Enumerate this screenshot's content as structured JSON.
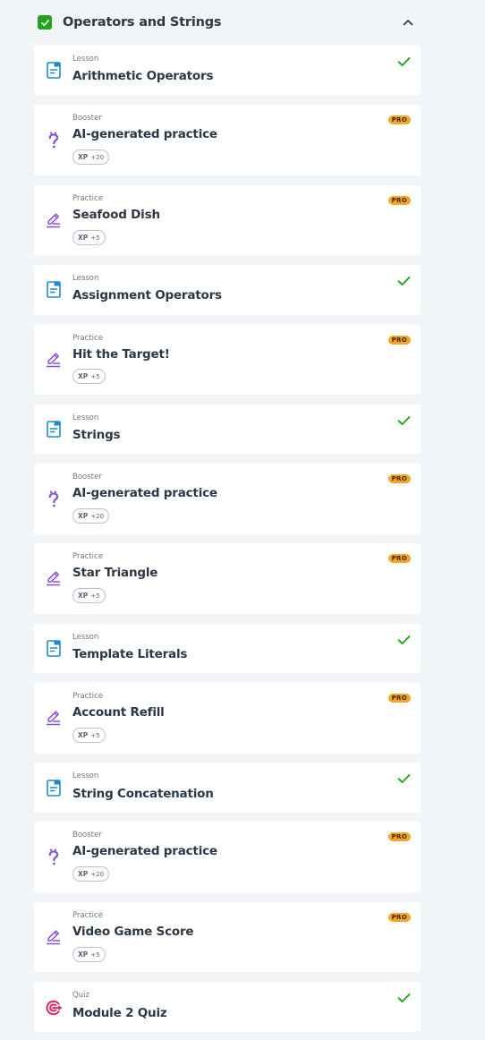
{
  "module": {
    "title": "Operators and Strings",
    "completed": true
  },
  "colors": {
    "lesson_icon": "#1a8ad4",
    "booster_icon": "#8a4fd8",
    "practice_icon": "#8a4fd8",
    "quiz_icon": "#e0245e",
    "check": "#1ea51a",
    "pro_badge": "#f5a623"
  },
  "items": [
    {
      "kind": "Lesson",
      "title": "Arithmetic Operators",
      "icon": "lesson-icon",
      "status": "completed"
    },
    {
      "kind": "Booster",
      "title": "AI-generated practice",
      "icon": "question-icon",
      "badge": "PRO",
      "xp_label": "XP",
      "xp_value": "+20"
    },
    {
      "kind": "Practice",
      "title": "Seafood Dish",
      "icon": "pencil-icon",
      "badge": "PRO",
      "xp_label": "XP",
      "xp_value": "+5"
    },
    {
      "kind": "Lesson",
      "title": "Assignment Operators",
      "icon": "lesson-icon",
      "status": "completed"
    },
    {
      "kind": "Practice",
      "title": "Hit the Target!",
      "icon": "pencil-icon",
      "badge": "PRO",
      "xp_label": "XP",
      "xp_value": "+5"
    },
    {
      "kind": "Lesson",
      "title": "Strings",
      "icon": "lesson-icon",
      "status": "completed"
    },
    {
      "kind": "Booster",
      "title": "AI-generated practice",
      "icon": "question-icon",
      "badge": "PRO",
      "xp_label": "XP",
      "xp_value": "+20"
    },
    {
      "kind": "Practice",
      "title": "Star Triangle",
      "icon": "pencil-icon",
      "badge": "PRO",
      "xp_label": "XP",
      "xp_value": "+5"
    },
    {
      "kind": "Lesson",
      "title": "Template Literals",
      "icon": "lesson-icon",
      "status": "completed"
    },
    {
      "kind": "Practice",
      "title": "Account Refill",
      "icon": "pencil-icon",
      "badge": "PRO",
      "xp_label": "XP",
      "xp_value": "+5"
    },
    {
      "kind": "Lesson",
      "title": "String Concatenation",
      "icon": "lesson-icon",
      "status": "completed"
    },
    {
      "kind": "Booster",
      "title": "AI-generated practice",
      "icon": "question-icon",
      "badge": "PRO",
      "xp_label": "XP",
      "xp_value": "+20"
    },
    {
      "kind": "Practice",
      "title": "Video Game Score",
      "icon": "pencil-icon",
      "badge": "PRO",
      "xp_label": "XP",
      "xp_value": "+5"
    },
    {
      "kind": "Quiz",
      "title": "Module 2 Quiz",
      "icon": "target-icon",
      "status": "completed"
    }
  ]
}
